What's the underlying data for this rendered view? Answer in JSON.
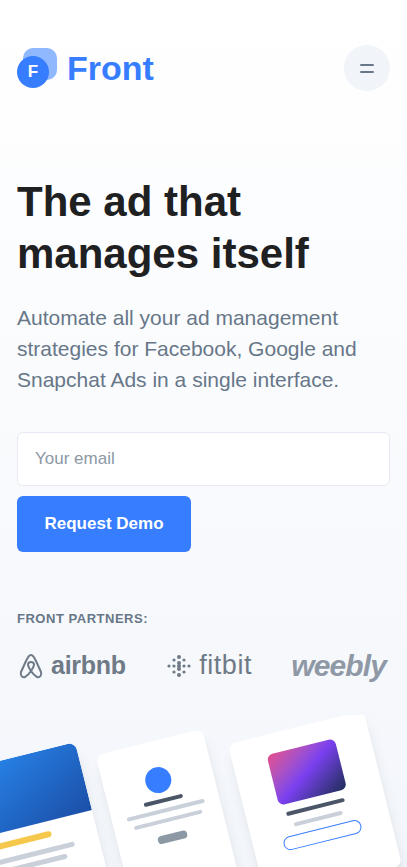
{
  "brand": {
    "initial": "F",
    "name": "Front"
  },
  "hero": {
    "title": "The ad that manages itself",
    "subtitle": "Automate all your ad management strategies for Facebook, Google and Snapchat Ads in a single interface."
  },
  "form": {
    "email_placeholder": "Your email",
    "button": "Request Demo"
  },
  "partners": {
    "label": "FRONT PARTNERS:",
    "logos": [
      "airbnb",
      "fitbit",
      "weebly"
    ]
  }
}
